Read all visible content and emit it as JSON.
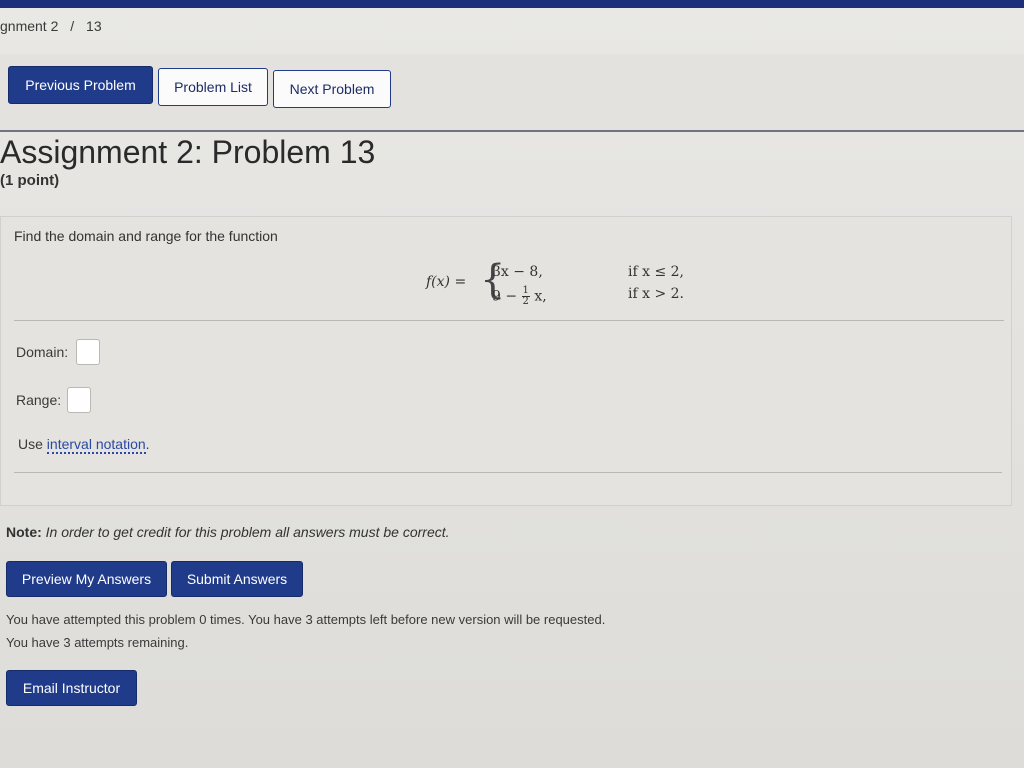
{
  "breadcrumb": {
    "assignment": "gnment 2",
    "separator": "/",
    "problem": "13"
  },
  "nav": {
    "previous": "Previous Problem",
    "list": "Problem List",
    "next": "Next Problem"
  },
  "page_title": "Assignment 2: Problem 13",
  "points": "(1 point)",
  "problem": {
    "prompt": "Find the domain and range for the function",
    "function_lhs": "f(x) =",
    "case1_expr": "3x − 8,",
    "case1_cond": "if x ≤ 2,",
    "case2_expr_a": "9 −",
    "case2_frac_num": "1",
    "case2_frac_den": "2",
    "case2_expr_b": "x,",
    "case2_cond": "if x > 2."
  },
  "answers": {
    "domain_label": "Domain:",
    "range_label": "Range:",
    "domain_value": "",
    "range_value": "",
    "hint_prefix": "Use",
    "hint_link": "interval notation",
    "hint_suffix": "."
  },
  "note": {
    "label": "Note:",
    "text": "In order to get credit for this problem all answers must be correct."
  },
  "actions": {
    "preview": "Preview My Answers",
    "submit": "Submit Answers",
    "email": "Email Instructor"
  },
  "status": {
    "attempts_line": "You have attempted this problem 0 times. You have 3 attempts left before new version will be requested.",
    "remaining_line": "You have 3 attempts remaining."
  },
  "colors": {
    "primary_button": "#1f3b8a",
    "link": "#2b48a4",
    "top_bar": "#1d2f7a"
  }
}
